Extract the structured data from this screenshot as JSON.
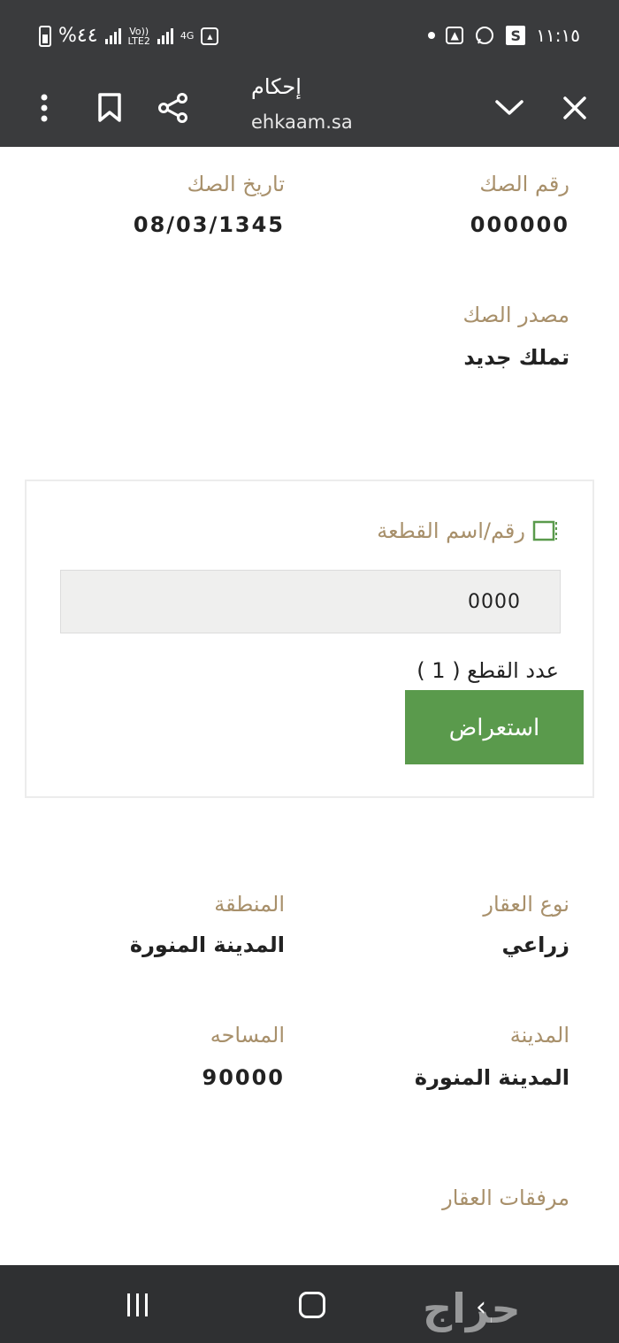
{
  "status_bar": {
    "time": "١١:١٥",
    "battery_text": "%٤٤",
    "volte_label": "Vo))\nLTE2",
    "network_label": "4G"
  },
  "toolbar": {
    "title": "إحكام",
    "url": "ehkaam.sa"
  },
  "deed": {
    "number_label": "رقم الصك",
    "number_value": "000000",
    "date_label": "تاريخ الصك",
    "date_value": "08/03/1345",
    "source_label": "مصدر الصك",
    "source_value": "تملك جديد"
  },
  "plot": {
    "label": "رقم/اسم القطعة",
    "input_value": "0000",
    "count_text": "عدد القطع ( 1 )",
    "view_button": "استعراض"
  },
  "property": {
    "type_label": "نوع العقار",
    "type_value": "زراعي",
    "region_label": "المنطقة",
    "region_value": "المدينة المنورة",
    "city_label": "المدينة",
    "city_value": "المدينة المنورة",
    "area_label": "المساحه",
    "area_value": "90000",
    "attachments_label": "مرفقات العقار"
  },
  "watermark": "حراج",
  "colors": {
    "bar_bg": "#3a3b3d",
    "label": "#a8906b",
    "button": "#5a9a4c"
  }
}
